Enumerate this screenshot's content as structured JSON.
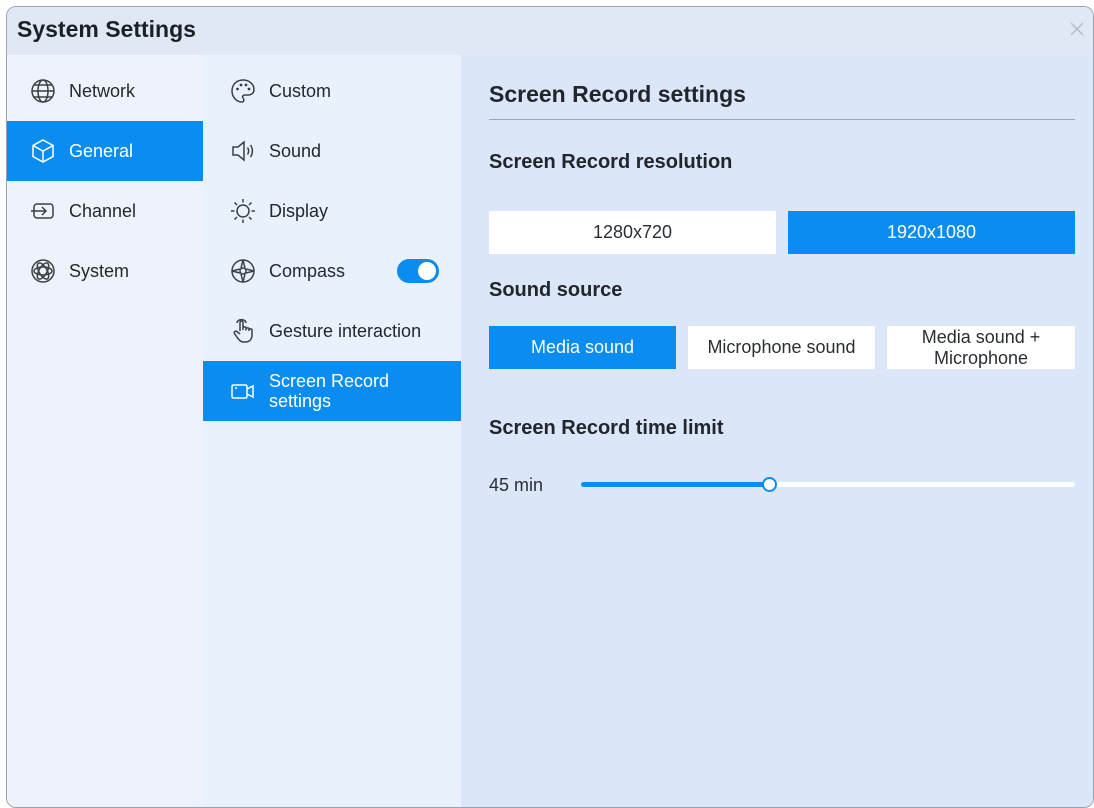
{
  "window": {
    "title": "System Settings",
    "close_icon": "close-icon"
  },
  "main_nav": [
    {
      "label": "Network",
      "icon": "globe-icon",
      "active": false
    },
    {
      "label": "General",
      "icon": "cube-icon",
      "active": true
    },
    {
      "label": "Channel",
      "icon": "input-source-icon",
      "active": false
    },
    {
      "label": "System",
      "icon": "atom-icon",
      "active": false
    }
  ],
  "sub_nav": [
    {
      "label": "Custom",
      "icon": "palette-icon",
      "active": false
    },
    {
      "label": "Sound",
      "icon": "speaker-icon",
      "active": false
    },
    {
      "label": "Display",
      "icon": "brightness-icon",
      "active": false
    },
    {
      "label": "Compass",
      "icon": "compass-icon",
      "active": false,
      "toggle_on": true
    },
    {
      "label": "Gesture interaction",
      "icon": "hand-pointer-icon",
      "active": false
    },
    {
      "label": "Screen Record settings",
      "label_lines": [
        "Screen Record",
        "settings"
      ],
      "icon": "video-camera-icon",
      "active": true
    }
  ],
  "content": {
    "heading": "Screen Record settings",
    "resolution": {
      "title": "Screen Record resolution",
      "options": [
        "1280x720",
        "1920x1080"
      ],
      "selected": "1920x1080"
    },
    "sound_source": {
      "title": "Sound source",
      "options": [
        {
          "label": "Media sound",
          "lines": [
            "Media sound"
          ]
        },
        {
          "label": "Microphone sound",
          "lines": [
            "Microphone sound"
          ]
        },
        {
          "label": "Media sound + Microphone",
          "lines": [
            "Media sound +",
            "Microphone"
          ]
        }
      ],
      "selected": "Media sound"
    },
    "time_limit": {
      "title": "Screen Record time limit",
      "value_label": "45 min",
      "fraction": 0.38
    }
  },
  "colors": {
    "accent": "#0a8cf0",
    "panel_main": "#dbe6f8",
    "panel_sub": "#e9f1fd",
    "panel_nav": "#eef3fb"
  }
}
